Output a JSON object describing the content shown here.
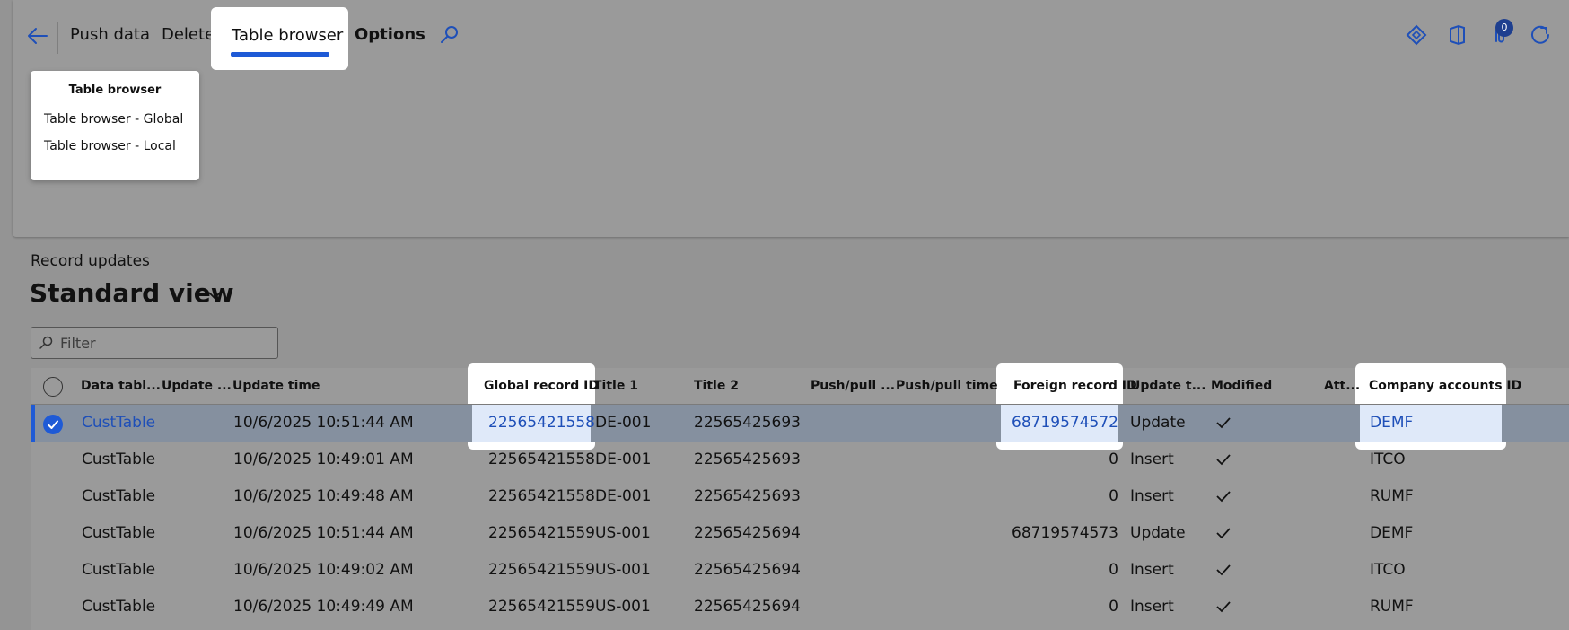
{
  "toolbar": {
    "items": [
      "Push data",
      "Delete",
      "Table browser",
      "Options"
    ],
    "active": "Table browser",
    "notification_count": "0"
  },
  "dropdown": {
    "header": "Table browser",
    "items": [
      "Table browser - Global",
      "Table browser - Local"
    ]
  },
  "page": {
    "section_title": "Record updates",
    "view_title": "Standard view"
  },
  "filter": {
    "placeholder": "Filter"
  },
  "grid": {
    "columns": [
      "Data tabl...",
      "Update ...",
      "Update time",
      "Global record ID",
      "Title 1",
      "Title 2",
      "Push/pull ...",
      "Push/pull time",
      "Foreign record ID",
      "Update t...",
      "Modified",
      "Att...",
      "Company accounts ID"
    ],
    "rows": [
      {
        "data_table": "CustTable",
        "update_time": "10/6/2025 10:51:44 AM",
        "global_id": "22565421558",
        "title1": "DE-001",
        "title2": "22565425693",
        "foreign_id": "68719574572",
        "update_type": "Update",
        "company": "DEMF"
      },
      {
        "data_table": "CustTable",
        "update_time": "10/6/2025 10:49:01 AM",
        "global_id": "22565421558",
        "title1": "DE-001",
        "title2": "22565425693",
        "foreign_id": "0",
        "update_type": "Insert",
        "company": "ITCO"
      },
      {
        "data_table": "CustTable",
        "update_time": "10/6/2025 10:49:48 AM",
        "global_id": "22565421558",
        "title1": "DE-001",
        "title2": "22565425693",
        "foreign_id": "0",
        "update_type": "Insert",
        "company": "RUMF"
      },
      {
        "data_table": "CustTable",
        "update_time": "10/6/2025 10:51:44 AM",
        "global_id": "22565421559",
        "title1": "US-001",
        "title2": "22565425694",
        "foreign_id": "68719574573",
        "update_type": "Update",
        "company": "DEMF"
      },
      {
        "data_table": "CustTable",
        "update_time": "10/6/2025 10:49:02 AM",
        "global_id": "22565421559",
        "title1": "US-001",
        "title2": "22565425694",
        "foreign_id": "0",
        "update_type": "Insert",
        "company": "ITCO"
      },
      {
        "data_table": "CustTable",
        "update_time": "10/6/2025 10:49:49 AM",
        "global_id": "22565421559",
        "title1": "US-001",
        "title2": "22565425694",
        "foreign_id": "0",
        "update_type": "Insert",
        "company": "RUMF"
      }
    ]
  },
  "colors": {
    "accent": "#1e5ad6",
    "link": "#1e4fb8",
    "selected_row": "#85909f"
  }
}
